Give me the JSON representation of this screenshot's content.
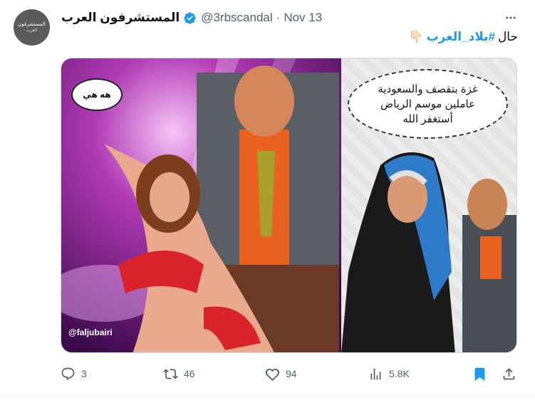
{
  "author": {
    "display_name": "المستشرفون العرب",
    "handle": "@3rbscandal",
    "date": "Nov 13",
    "separator": "·",
    "avatar_text_1": "المستشرفون",
    "avatar_text_2": "العرب"
  },
  "tweet": {
    "prefix": "حال",
    "hashtag": "#بلاد_العرب",
    "emoji": "👇🏻"
  },
  "media": {
    "left_bubble": "هه هي",
    "right_bubble_line1": "غزة بتقصف والسعودية",
    "right_bubble_line2": "عاملين موسم الرياض",
    "right_bubble_line3": "أستغفر الله",
    "watermark": "@faljubairi"
  },
  "actions": {
    "replies": "3",
    "retweets": "46",
    "likes": "94",
    "views": "5.8K"
  },
  "colors": {
    "accent": "#1d9bf0",
    "muted": "#536471",
    "bookmark": "#1d9bf0"
  }
}
